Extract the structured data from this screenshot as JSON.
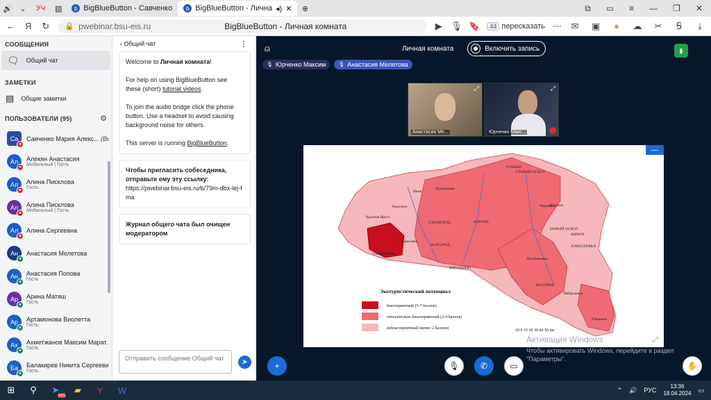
{
  "browser": {
    "tab_yu": "Уч",
    "tabs": [
      {
        "title": "BigBlueButton - Савченко"
      },
      {
        "title": "BigBlueButton - Лична"
      }
    ],
    "url": "pwebinar.bsu-eis.ru",
    "page_title": "BigBlueButton - Личная комната",
    "translate_label": "пересказать",
    "translate_badge": "44"
  },
  "sidebar": {
    "messages_title": "СООБЩЕНИЯ",
    "public_chat": "Общий чат",
    "notes_title": "ЗАМЕТКИ",
    "shared_notes": "Общие заметки",
    "users_title": "ПОЛЬЗОВАТЕЛИ (95)",
    "users": [
      {
        "initials": "Са",
        "name": "Савченко Мария Алекс...",
        "suffix": "(Вы)",
        "role": "",
        "color": "#2b4aa0",
        "mic": "#d9302b",
        "square": true
      },
      {
        "initials": "Ал",
        "name": "Алекян Анастасия",
        "role": "Мобильный | Гость",
        "color": "#1c5ec9",
        "mic": "#d9302b"
      },
      {
        "initials": "Ал",
        "name": "Алина Писклова",
        "role": "Гость",
        "color": "#1c5ec9",
        "mic": "#d9302b"
      },
      {
        "initials": "Ал",
        "name": "Алина Писклова",
        "role": "Мобильный | Гость",
        "color": "#6a2fa3",
        "mic": "#d9302b"
      },
      {
        "initials": "Ал",
        "name": "Алина Сергеевна",
        "role": "",
        "color": "#1c5ec9",
        "mic": "#d9302b"
      },
      {
        "initials": "Ан",
        "name": "Анастасия Мелетова",
        "role": "",
        "color": "#1d3a80",
        "mic": "#1f8a55"
      },
      {
        "initials": "Ан",
        "name": "Анастасия Попова",
        "role": "Гость",
        "color": "#1c5ec9",
        "mic": "#1f8a55"
      },
      {
        "initials": "Ар",
        "name": "Арина Матяш",
        "role": "Гость",
        "color": "#6a2fa3",
        "mic": "#1f8a55"
      },
      {
        "initials": "Ар",
        "name": "Артамонова Виолетта",
        "role": "Гость",
        "color": "#1c5ec9",
        "mic": "#1f8a55"
      },
      {
        "initials": "Ах",
        "name": "Ахметжанов Максим Марат...",
        "role": "Гость",
        "color": "#1c5ec9",
        "mic": "#1f8a55"
      },
      {
        "initials": "Ба",
        "name": "Балакирев Никита Сергеевич",
        "role": "Гость",
        "color": "#1c5ec9",
        "mic": "#1f8a55"
      }
    ]
  },
  "chat": {
    "header": "Общий чат",
    "welcome_prefix": "Welcome to ",
    "welcome_room": "Личная комната",
    "welcome_suffix": "!",
    "help_prefix": "For help on using BigBlueButton see these (short) ",
    "help_link": "tutorial videos",
    "help_suffix": ".",
    "audio_text": "To join the audio bridge click the phone button. Use a headset to avoid causing background noise for others.",
    "server_prefix": "This server is running ",
    "server_link": "BigBlueButton",
    "server_suffix": ".",
    "invite_title": "Чтобы пригласить собеседника, отправьте ему эту ссылку:",
    "invite_link": "https://pwebinar.bsu-eis.ru/b/79m-dbx-lej-fma",
    "cleared": "Журнал общего чата был очищен модератором",
    "input_placeholder": "Отправить сообщение Общий чат"
  },
  "main": {
    "room_name": "Личная комната",
    "record_label": "Включить запись",
    "talkers": [
      "Юрченко Максим",
      "Анастасия Мелетова"
    ],
    "cams": [
      "Анастасия Ме...",
      "Юрченко Макс..."
    ],
    "activation_title": "Активация Windows",
    "activation_text": "Чтобы активировать Windows, перейдите в раздел \"Параметры\"."
  },
  "map": {
    "legend_title": "Экотуристический потенциал",
    "legend": [
      {
        "label": "благоприятный (5-7 баллов)",
        "color": "#c8101e"
      },
      {
        "label": "относительно благоприятный (2-4 баллов)",
        "color": "#ef6a72"
      },
      {
        "label": "неблагоприятный (менее 2 баллов)",
        "color": "#f6b8bc"
      }
    ],
    "scale": "10 0 10 20 30 40 50 км",
    "cities": [
      "ГУБКИН",
      "СТАРЫЙ ОСКОЛ",
      "Ивня",
      "Прохоровка",
      "Чернянка",
      "Красная Яруга",
      "Ракитное",
      "СТРОИТЕЛЬ",
      "КОРОЧА",
      "НОВЫЙ ОСКОЛ",
      "Красное",
      "БИРЮЧ",
      "Борисовка",
      "БЕЛГОРОД",
      "АЛЕКСЕЕВКА",
      "ГРАЙВОРОН",
      "ШЕБЕКИНО",
      "Волоконовка",
      "ВАЛУЙКИ",
      "Вейделевка",
      "Ровеньки"
    ]
  },
  "taskbar": {
    "lang": "РУС",
    "time": "13:36",
    "date": "18.04.2024",
    "telegram_badge": "665"
  }
}
